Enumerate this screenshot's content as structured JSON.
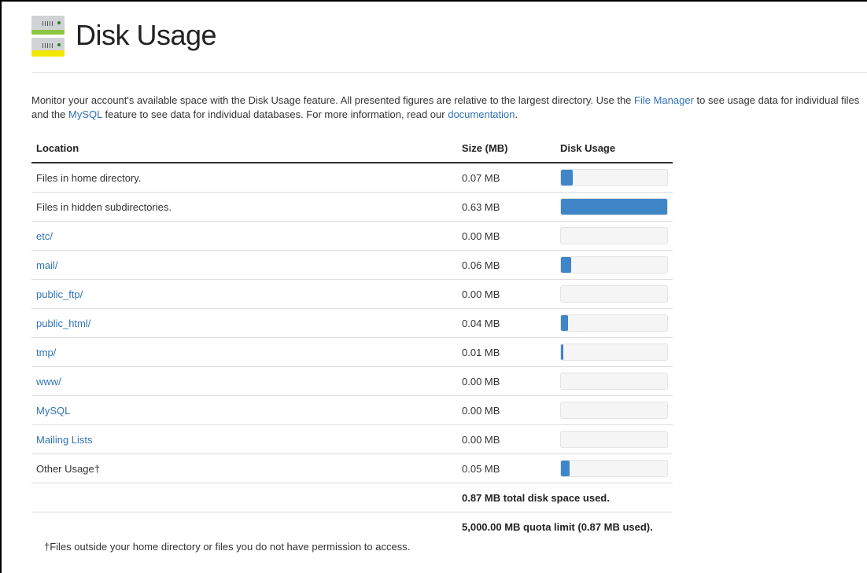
{
  "page": {
    "title": "Disk Usage",
    "icon": "server-disk-icon"
  },
  "description": {
    "part1": "Monitor your account's available space with the Disk Usage feature. All presented figures are relative to the largest directory. Use the ",
    "file_manager_link": "File Manager",
    "part2": " to see usage data for individual files and the ",
    "mysql_link": "MySQL",
    "part3": " feature to see data for individual databases. For more information, read our ",
    "documentation_link": "documentation",
    "part4": "."
  },
  "table": {
    "headers": {
      "location": "Location",
      "size": "Size (MB)",
      "usage": "Disk Usage"
    },
    "rows": [
      {
        "location": "Files in home directory.",
        "is_link": false,
        "size": "0.07 MB",
        "usage_fraction": 0.11
      },
      {
        "location": "Files in hidden subdirectories.",
        "is_link": false,
        "size": "0.63 MB",
        "usage_fraction": 1.0
      },
      {
        "location": "etc/",
        "is_link": true,
        "size": "0.00 MB",
        "usage_fraction": 0.0
      },
      {
        "location": "mail/",
        "is_link": true,
        "size": "0.06 MB",
        "usage_fraction": 0.095
      },
      {
        "location": "public_ftp/",
        "is_link": true,
        "size": "0.00 MB",
        "usage_fraction": 0.0
      },
      {
        "location": "public_html/",
        "is_link": true,
        "size": "0.04 MB",
        "usage_fraction": 0.063
      },
      {
        "location": "tmp/",
        "is_link": true,
        "size": "0.01 MB",
        "usage_fraction": 0.016
      },
      {
        "location": "www/",
        "is_link": true,
        "size": "0.00 MB",
        "usage_fraction": 0.0
      },
      {
        "location": "MySQL",
        "is_link": true,
        "size": "0.00 MB",
        "usage_fraction": 0.0
      },
      {
        "location": "Mailing Lists",
        "is_link": true,
        "size": "0.00 MB",
        "usage_fraction": 0.0
      },
      {
        "location": "Other Usage†",
        "is_link": false,
        "size": "0.05 MB",
        "usage_fraction": 0.079
      }
    ],
    "total": "0.87 MB total disk space used.",
    "quota": "5,000.00 MB quota limit (0.87 MB used)."
  },
  "footnote": "†Files outside your home directory or files you do not have permission to access.",
  "colors": {
    "link": "#3073b8",
    "bar_fill": "#3e86c8",
    "bar_track": "#f5f5f5"
  }
}
